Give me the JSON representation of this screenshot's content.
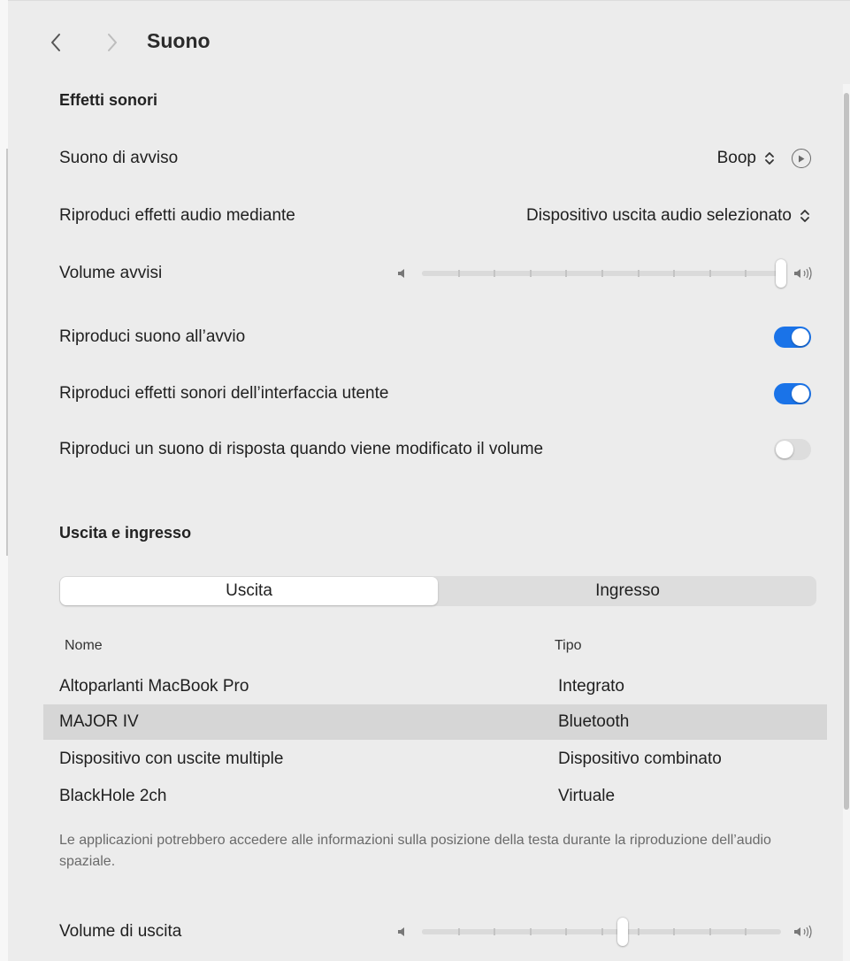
{
  "window": {
    "title": "Suono"
  },
  "effects": {
    "section_title": "Effetti sonori",
    "alert_sound": {
      "label": "Suono di avviso",
      "value": "Boop"
    },
    "play_through": {
      "label": "Riproduci effetti audio mediante",
      "value": "Dispositivo uscita audio selezionato"
    },
    "alert_volume": {
      "label": "Volume avvisi",
      "level_percent": 100
    },
    "startup_sound": {
      "label": "Riproduci suono all’avvio",
      "on": true
    },
    "ui_sounds": {
      "label": "Riproduci effetti sonori dell’interfaccia utente",
      "on": true
    },
    "volume_feedback": {
      "label": "Riproduci un suono di risposta quando viene modificato il volume",
      "on": false
    }
  },
  "io": {
    "section_title": "Uscita e ingresso",
    "tabs": [
      {
        "label": "Uscita",
        "active": true
      },
      {
        "label": "Ingresso",
        "active": false
      }
    ],
    "columns": {
      "name": "Nome",
      "type": "Tipo"
    },
    "devices": [
      {
        "name": "Altoparlanti MacBook Pro",
        "type": "Integrato",
        "selected": false
      },
      {
        "name": "MAJOR IV",
        "type": "Bluetooth",
        "selected": true
      },
      {
        "name": "Dispositivo con uscite multiple",
        "type": "Dispositivo combinato",
        "selected": false
      },
      {
        "name": "BlackHole 2ch",
        "type": "Virtuale",
        "selected": false
      }
    ],
    "note": "Le applicazioni potrebbero accedere alle informazioni sulla posizione della testa durante la riproduzione dell’audio spaziale.",
    "output_volume": {
      "label": "Volume di uscita",
      "level_percent": 56
    }
  },
  "colors": {
    "toggle_on": "#1a73e8",
    "selected_row": "#d6d6d6"
  }
}
